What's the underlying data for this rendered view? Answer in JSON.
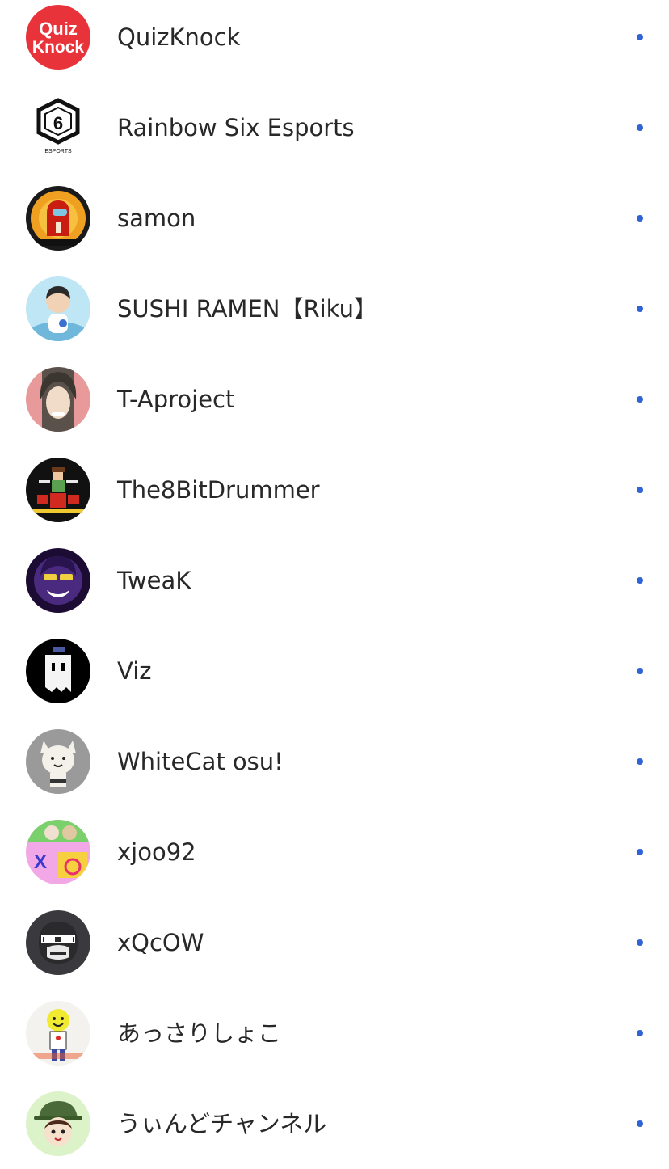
{
  "colors": {
    "new_content_dot": "#2f63d6",
    "text": "#282828"
  },
  "channels": [
    {
      "name": "QuizKnock",
      "avatar_text_line1": "Quiz",
      "avatar_text_line2": "Knock",
      "new_content": true
    },
    {
      "name": "Rainbow Six Esports",
      "avatar_text_line1": "6",
      "avatar_text_line2": "ESPORTS",
      "new_content": true
    },
    {
      "name": "samon",
      "new_content": true
    },
    {
      "name": "SUSHI RAMEN【Riku】",
      "new_content": true
    },
    {
      "name": "T-Aproject",
      "new_content": true
    },
    {
      "name": "The8BitDrummer",
      "new_content": true
    },
    {
      "name": "TweaK",
      "new_content": true
    },
    {
      "name": "Viz",
      "new_content": true
    },
    {
      "name": "WhiteCat osu!",
      "new_content": true
    },
    {
      "name": "xjoo92",
      "avatar_text_line1": "X",
      "new_content": true
    },
    {
      "name": "xQcOW",
      "new_content": true
    },
    {
      "name": "あっさりしょこ",
      "new_content": true
    },
    {
      "name": "うぃんどチャンネル",
      "new_content": true
    }
  ]
}
